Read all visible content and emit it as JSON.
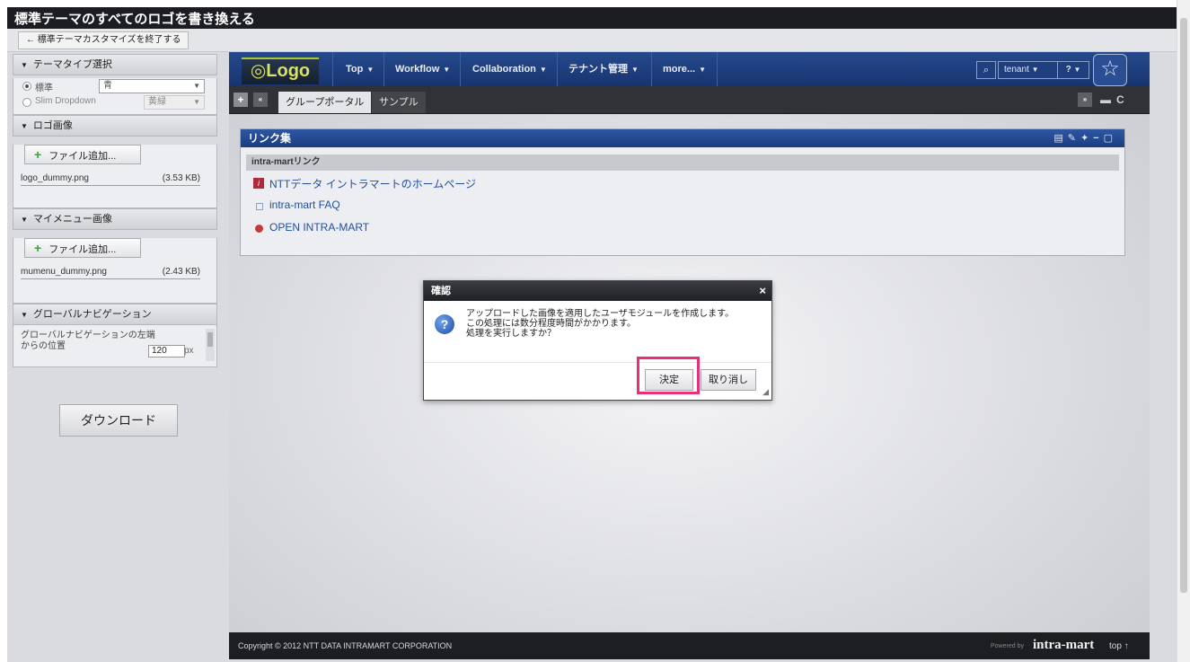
{
  "window": {
    "title": "標準テーマのすべてのロゴを書き換える",
    "end_button": "← 標準テーマカスタマイズを終了する"
  },
  "left_panel": {
    "theme_section": {
      "title": "テーマタイプ選択",
      "standard_label": "標準",
      "standard_value": "青",
      "slim_label": "Slim Dropdown",
      "slim_value": "黄緑"
    },
    "logo_section": {
      "title": "ロゴ画像",
      "add_button": "ファイル追加...",
      "file_name": "logo_dummy.png",
      "file_size": "(3.53 KB)"
    },
    "mymenu_section": {
      "title": "マイメニュー画像",
      "add_button": "ファイル追加...",
      "file_name": "mumenu_dummy.png",
      "file_size": "(2.43 KB)"
    },
    "gnav_section": {
      "title": "グローバルナビゲーション",
      "label": "グローバルナビゲーションの左端からの位置",
      "value": "120",
      "unit": "px"
    },
    "download_button": "ダウンロード"
  },
  "portal": {
    "logo": "◎Logo",
    "menus": [
      "Top",
      "Workflow",
      "Collaboration",
      "テナント管理",
      "more..."
    ],
    "tenant": "tenant",
    "help": "?",
    "tabs": {
      "active": "グループポータル",
      "other": "サンプル"
    },
    "portlet": {
      "title": "リンク集",
      "group": "intra-martリンク",
      "links": [
        "NTTデータ イントラマートのホームページ",
        "intra-mart FAQ",
        "OPEN INTRA-MART"
      ]
    },
    "footer": {
      "copyright": "Copyright © 2012 NTT DATA INTRAMART CORPORATION",
      "powered": "Powered by",
      "brand": "intra-mart",
      "top": "top ↑"
    }
  },
  "dialog": {
    "title": "確認",
    "line1": "アップロードした画像を適用したユーザモジュールを作成します。",
    "line2": "この処理には数分程度時間がかかります。",
    "line3": "処理を実行しますか？",
    "ok": "決定",
    "cancel": "取り消し"
  },
  "colors": {
    "highlight": "#e72f7a",
    "nav": "#1f3f7e"
  }
}
